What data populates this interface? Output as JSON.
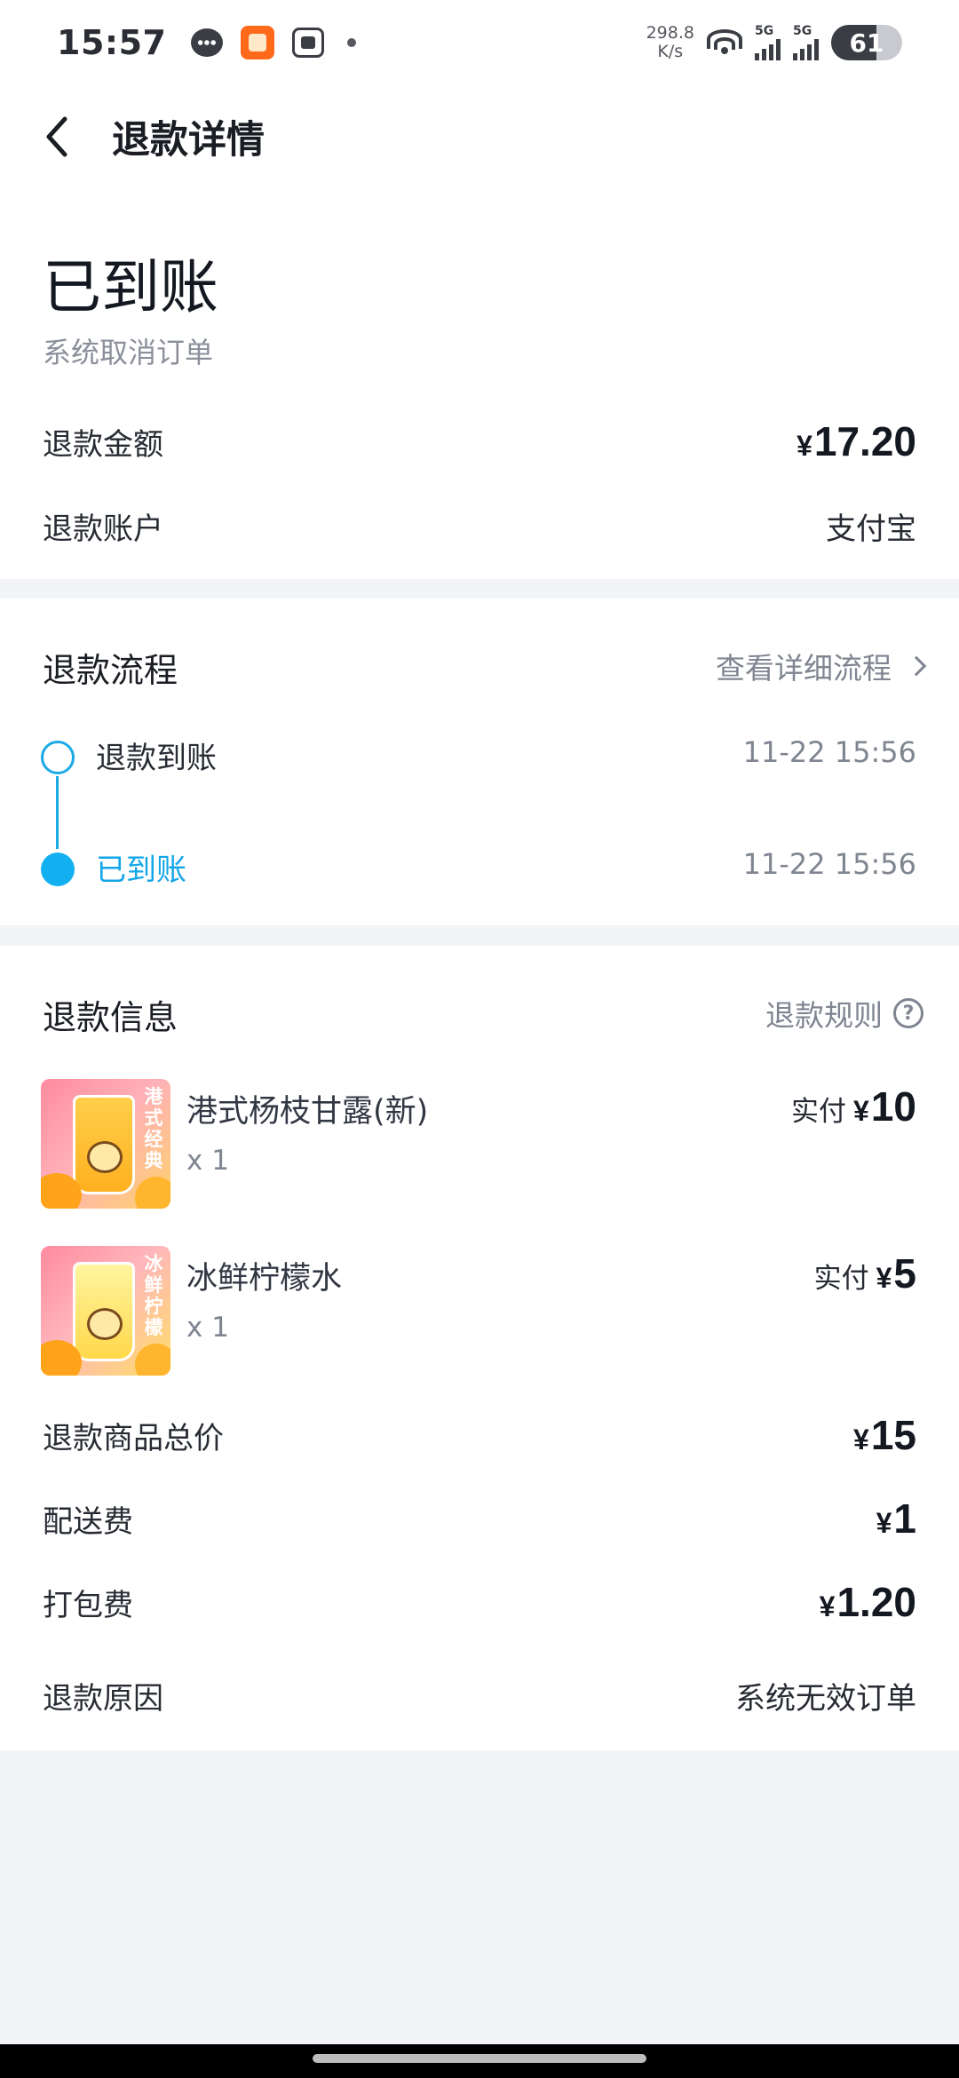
{
  "status_bar": {
    "time": "15:57",
    "speed_value": "298.8",
    "speed_unit": "K/s",
    "signal_1": "5G",
    "signal_2": "5G",
    "battery": "61",
    "icons": [
      "chat-bubble-icon",
      "app-notification-icon",
      "screenshot-icon",
      "dot-icon",
      "wifi-icon",
      "signal-icon",
      "battery-charging-icon"
    ]
  },
  "header": {
    "back_icon": "chevron-left-icon",
    "title": "退款详情"
  },
  "summary": {
    "status": "已到账",
    "reason_sub": "系统取消订单",
    "amount_label": "退款金额",
    "amount_currency": "¥",
    "amount_value": "17.20",
    "account_label": "退款账户",
    "account_value": "支付宝"
  },
  "flow": {
    "title": "退款流程",
    "link": "查看详细流程",
    "steps": [
      {
        "label": "退款到账",
        "time": "11-22 15:56",
        "state": "done"
      },
      {
        "label": "已到账",
        "time": "11-22 15:56",
        "state": "current"
      }
    ],
    "accent_color": "#12b0f0"
  },
  "info": {
    "title": "退款信息",
    "rules_link": "退款规则",
    "items": [
      {
        "name": "港式杨枝甘露(新)",
        "qty": "x 1",
        "paid_label": "实付",
        "currency": "¥",
        "paid": "10",
        "thumb_tag": "港式经典"
      },
      {
        "name": "冰鲜柠檬水",
        "qty": "x 1",
        "paid_label": "实付",
        "currency": "¥",
        "paid": "5",
        "thumb_tag": "冰鲜柠檬"
      }
    ],
    "goods_total_label": "退款商品总价",
    "goods_total_currency": "¥",
    "goods_total": "15",
    "delivery_label": "配送费",
    "delivery_currency": "¥",
    "delivery": "1",
    "packing_label": "打包费",
    "packing_currency": "¥",
    "packing": "1.20",
    "reason_label": "退款原因",
    "reason_value": "系统无效订单"
  }
}
